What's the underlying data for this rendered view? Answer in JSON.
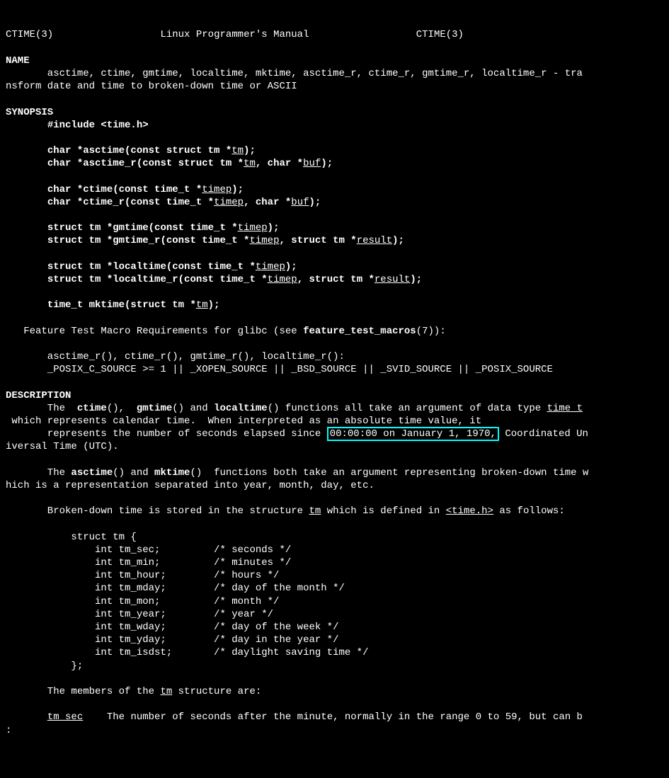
{
  "header": {
    "left": "CTIME(3)",
    "center": "Linux Programmer's Manual",
    "right": "CTIME(3)"
  },
  "sections": {
    "name_hdr": "NAME",
    "name_body": "       asctime, ctime, gmtime, localtime, mktime, asctime_r, ctime_r, gmtime_r, localtime_r - tra\nnsform date and time to broken-down time or ASCII",
    "syn_hdr": "SYNOPSIS",
    "syn_inc1": "       ",
    "syn_inc2": "#include <time.h>",
    "asctime_pre": "       ",
    "asctime_ret": "char *asctime(const struct tm *",
    "asctime_arg": "tm",
    "asctime_post": ");",
    "asctime_r_pre": "       ",
    "asctime_r_ret": "char *asctime_r(const struct tm *",
    "asctime_r_arg1": "tm",
    "asctime_r_mid": ", char *",
    "asctime_r_arg2": "buf",
    "asctime_r_post": ");",
    "ctime_pre": "       ",
    "ctime_ret": "char *ctime(const time_t *",
    "ctime_arg": "timep",
    "ctime_post": ");",
    "ctime_r_pre": "       ",
    "ctime_r_ret": "char *ctime_r(const time_t *",
    "ctime_r_arg1": "timep",
    "ctime_r_mid": ", char *",
    "ctime_r_arg2": "buf",
    "ctime_r_post": ");",
    "gmtime_pre": "       ",
    "gmtime_ret": "struct tm *gmtime(const time_t *",
    "gmtime_arg": "timep",
    "gmtime_post": ");",
    "gmtime_r_pre": "       ",
    "gmtime_r_ret": "struct tm *gmtime_r(const time_t *",
    "gmtime_r_arg1": "timep",
    "gmtime_r_mid": ", struct tm *",
    "gmtime_r_arg2": "result",
    "gmtime_r_post": ");",
    "localtime_pre": "       ",
    "localtime_ret": "struct tm *localtime(const time_t *",
    "localtime_arg": "timep",
    "localtime_post": ");",
    "localtime_r_pre": "       ",
    "localtime_r_ret": "struct tm *localtime_r(const time_t *",
    "localtime_r_arg1": "timep",
    "localtime_r_mid": ", struct tm *",
    "localtime_r_arg2": "result",
    "localtime_r_post": ");",
    "mktime_pre": "       ",
    "mktime_ret": "time_t mktime(struct tm *",
    "mktime_arg": "tm",
    "mktime_post": ");",
    "feat_pre": "   Feature Test Macro Requirements for glibc (see ",
    "feat_bold": "feature_test_macros",
    "feat_post": "(7)):",
    "feat_line2": "       asctime_r(), ctime_r(), gmtime_r(), localtime_r():",
    "feat_line3": "       _POSIX_C_SOURCE >= 1 || _XOPEN_SOURCE || _BSD_SOURCE || _SVID_SOURCE || _POSIX_SOURCE",
    "desc_hdr": "DESCRIPTION",
    "desc_p1_a": "       The  ",
    "desc_p1_b": "ctime",
    "desc_p1_c": "(),  ",
    "desc_p1_d": "gmtime",
    "desc_p1_e": "() and ",
    "desc_p1_f": "localtime",
    "desc_p1_g": "() functions all take an argument of data type ",
    "desc_p1_h": "time_t",
    "desc_p1_i": "\n which represents calendar time.  When interpreted as an absolute time value, it\n       represents the number of seconds elapsed since ",
    "desc_p1_hl": "00:00:00 on January 1, 1970,",
    "desc_p1_j": " Coordinated Un\niversal Time (UTC).",
    "desc_p2_a": "       The ",
    "desc_p2_b": "asctime",
    "desc_p2_c": "() and ",
    "desc_p2_d": "mktime",
    "desc_p2_e": "()  functions both take an argument representing broken-down time w\nhich is a representation separated into year, month, day, etc.",
    "desc_p3_a": "       Broken-down time is stored in the structure ",
    "desc_p3_b": "tm",
    "desc_p3_c": " which is defined in ",
    "desc_p3_d": "<time.h>",
    "desc_p3_e": " as follows:",
    "struct_block": "           struct tm {\n               int tm_sec;         /* seconds */\n               int tm_min;         /* minutes */\n               int tm_hour;        /* hours */\n               int tm_mday;        /* day of the month */\n               int tm_mon;         /* month */\n               int tm_year;        /* year */\n               int tm_wday;        /* day of the week */\n               int tm_yday;        /* day in the year */\n               int tm_isdst;       /* daylight saving time */\n           };",
    "members_intro_a": "       The members of the ",
    "members_intro_b": "tm",
    "members_intro_c": " structure are:",
    "tm_sec_a": "       ",
    "tm_sec_b": "tm_sec",
    "tm_sec_c": "    The number of seconds after the minute, normally in the range 0 to 59, but can b",
    "prompt": ":"
  }
}
